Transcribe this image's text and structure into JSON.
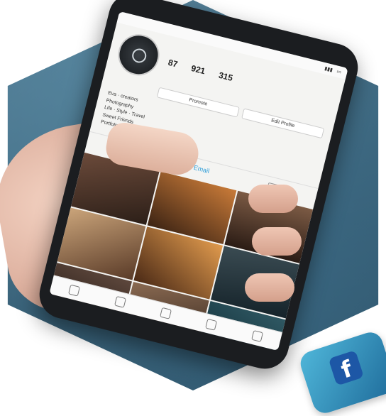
{
  "profile": {
    "stats": [
      {
        "value": "87"
      },
      {
        "value": "921"
      },
      {
        "value": "315"
      }
    ],
    "buttons": {
      "promote": "Promote",
      "edit": "Edit Profile"
    },
    "bio_lines": [
      "Eva · creators",
      "Photography",
      "Life · Style · Travel",
      "Sweet Friends",
      "Portfolio"
    ]
  },
  "tabs": {
    "active_label": "Email"
  },
  "badge": {
    "letter": "f"
  }
}
